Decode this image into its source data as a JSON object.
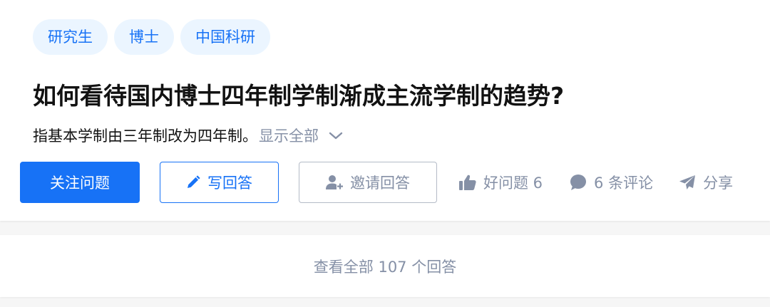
{
  "topics": [
    "研究生",
    "博士",
    "中国科研"
  ],
  "question": {
    "title": "如何看待国内博士四年制学制渐成主流学制的趋势?",
    "detail": "指基本学制由三年制改为四年制。",
    "show_all": "显示全部"
  },
  "actions": {
    "follow": "关注问题",
    "write_answer": "写回答",
    "invite": "邀请回答",
    "good_question": "好问题 6",
    "comments": "6 条评论",
    "share": "分享"
  },
  "answers": {
    "view_all": "查看全部 107 个回答"
  },
  "colors": {
    "brand": "#1772f6",
    "topic_bg": "#ebf5ff",
    "muted": "#8590a6",
    "text": "#121212"
  },
  "icons": {
    "show_all": "chevron-down-icon",
    "write_answer": "pencil-icon",
    "invite": "user-plus-icon",
    "good_question": "thumbs-up-icon",
    "comments": "comment-bubble-icon",
    "share": "paper-plane-icon"
  }
}
